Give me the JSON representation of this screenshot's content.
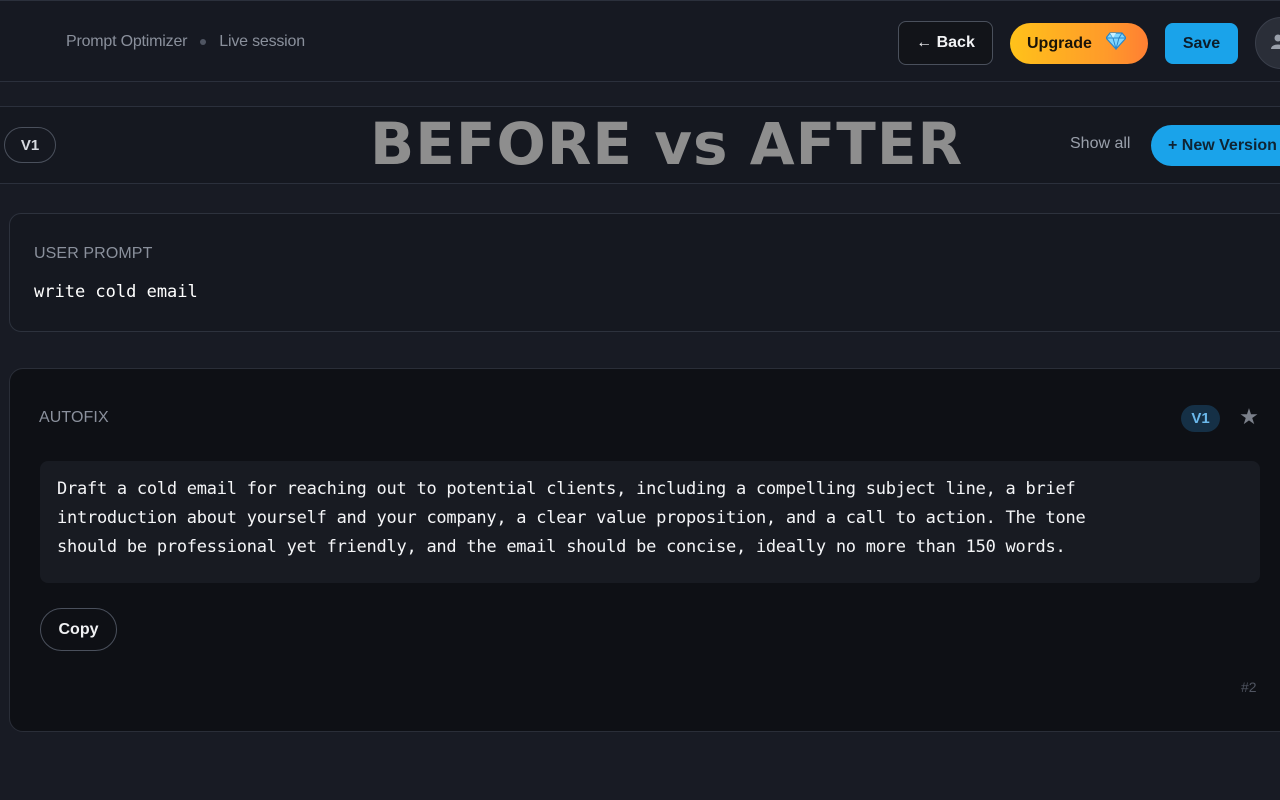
{
  "header": {
    "breadcrumb": [
      "Prompt Optimizer",
      "Live session"
    ],
    "back_label": "← Back",
    "upgrade_label": "Upgrade",
    "upgrade_icon": "gem-icon",
    "save_label": "Save"
  },
  "versions": {
    "current_pill": "V1",
    "banner_title": "BEFORE vs AFTER",
    "show_all_label": "Show all",
    "new_version_label": "+ New Version"
  },
  "user_prompt": {
    "label": "USER PROMPT",
    "text": "write cold email"
  },
  "autofix": {
    "label": "AUTOFIX",
    "version_badge": "V1",
    "text_lines": [
      "Draft a cold email for reaching out to potential clients, including a compelling subject line, a brief",
      "introduction about yourself and your company, a clear value proposition, and a call to action. The tone",
      "should be professional yet friendly, and the email should be concise, ideally no more than 150 words."
    ],
    "copy_label": "Copy",
    "index_label": "#2"
  },
  "colors": {
    "accent_blue": "#1aa3ea",
    "upgrade_gradient_start": "#ffc21a",
    "upgrade_gradient_end": "#ff7f33",
    "background": "#181b24"
  }
}
